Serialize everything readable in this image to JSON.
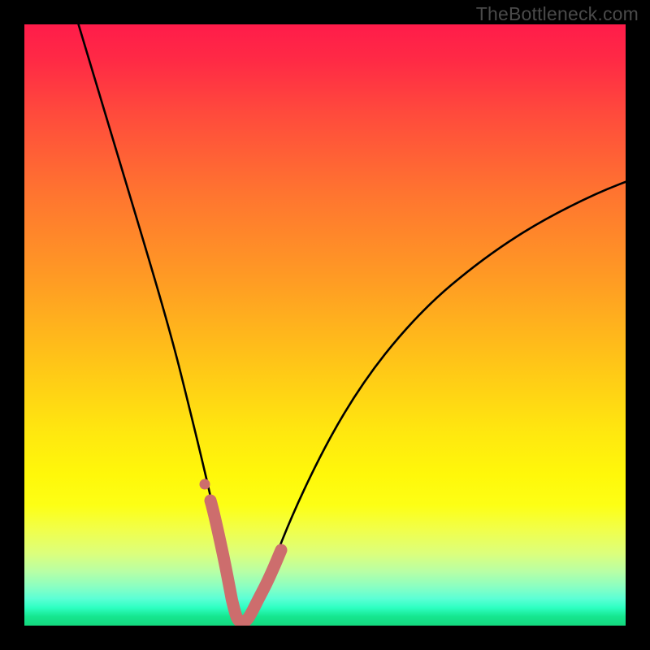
{
  "watermark": "TheBottleneck.com",
  "chart_data": {
    "type": "line",
    "title": "",
    "xlabel": "",
    "ylabel": "",
    "x_range": [
      0,
      100
    ],
    "y_range": [
      0,
      100
    ],
    "series": [
      {
        "name": "bottleneck-curve",
        "color": "#000000",
        "x": [
          9,
          12,
          15,
          18,
          21,
          24,
          26,
          28,
          30,
          31.5,
          33,
          34,
          35,
          36,
          37,
          38,
          40,
          42,
          45,
          48,
          52,
          56,
          60,
          65,
          70,
          75,
          80,
          85,
          90,
          95,
          100
        ],
        "y": [
          100,
          90,
          80,
          70,
          60,
          50,
          42,
          34,
          26,
          19,
          12,
          7,
          3,
          1,
          0.5,
          1,
          3,
          7,
          13,
          19,
          26,
          32,
          37.5,
          43,
          47.5,
          51.5,
          55,
          58,
          60.5,
          62.5,
          64
        ]
      },
      {
        "name": "highlight-segment",
        "color": "#cd6d6d",
        "x": [
          30.2,
          31.5,
          33,
          34,
          35,
          36,
          37,
          38,
          39.5,
          41,
          42.5
        ],
        "y": [
          24,
          19,
          12,
          7,
          3,
          1,
          0.5,
          1,
          2.5,
          5.5,
          9
        ]
      }
    ],
    "background_gradient": {
      "top_color": "#ff1c4a",
      "mid_color": "#ffe80f",
      "bottom_color": "#14d87e"
    }
  }
}
